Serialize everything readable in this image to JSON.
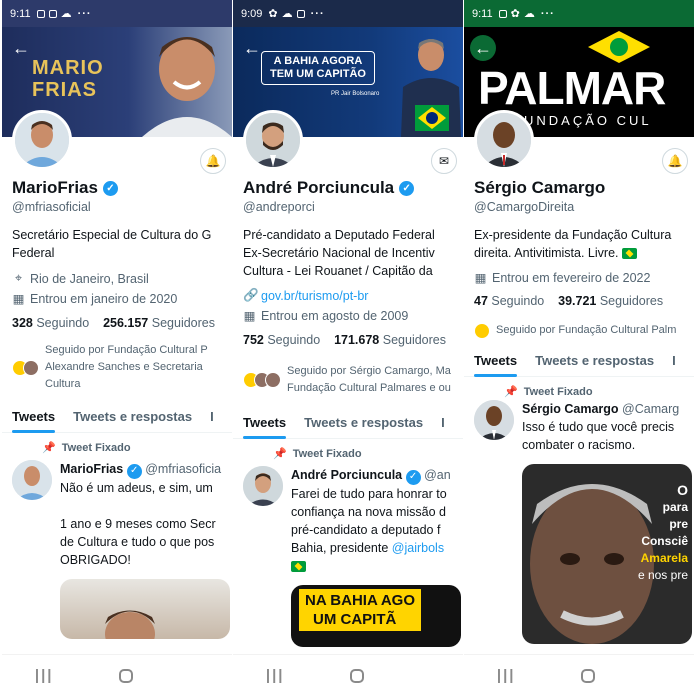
{
  "panels": [
    {
      "status": {
        "time": "9:11",
        "more": "···"
      },
      "banner": {
        "line1": "MARIO",
        "line2": "FRIAS"
      },
      "name": "MarioFrias",
      "handle": "@mfriasoficial",
      "bio": [
        "Secretário Especial de Cultura do G",
        "Federal"
      ],
      "location": "Rio de Janeiro, Brasil",
      "joined": "Entrou em janeiro de 2020",
      "following_count": "328",
      "following_label": "Seguindo",
      "followers_count": "256.157",
      "followers_label": "Seguidores",
      "followed_by": [
        "Seguido por Fundação Cultural P",
        "Alexandre Sanches e Secretaria",
        "Cultura"
      ],
      "tabs": [
        "Tweets",
        "Tweets e respostas",
        "I"
      ],
      "pinned_label": "Tweet Fixado",
      "tweet": {
        "name": "MarioFrias",
        "handle": "@mfriasoficia",
        "lines": [
          "Não é um adeus, e sim, um",
          "",
          "1 ano e 9 meses como Secr",
          "de Cultura e tudo o que pos",
          "OBRIGADO!"
        ]
      }
    },
    {
      "status": {
        "time": "9:09",
        "more": "···"
      },
      "banner": {
        "line1": "A BAHIA AGORA",
        "line2": "TEM UM CAPITÃO",
        "signature": "PR Jair Bolsonaro"
      },
      "name": "André Porciuncula",
      "handle": "@andreporci",
      "bio": [
        "Pré-candidato a Deputado Federal",
        "Ex-Secretário Nacional de Incentiv",
        "Cultura - Lei Rouanet / Capitão da"
      ],
      "link": "gov.br/turismo/pt-br",
      "joined": "Entrou em agosto de 2009",
      "following_count": "752",
      "following_label": "Seguindo",
      "followers_count": "171.678",
      "followers_label": "Seguidores",
      "followed_by": [
        "Seguido por Sérgio Camargo, Ma",
        "Fundação Cultural Palmares e ou"
      ],
      "tabs": [
        "Tweets",
        "Tweets e respostas",
        "I"
      ],
      "pinned_label": "Tweet Fixado",
      "tweet": {
        "name": "André Porciuncula",
        "handle": "@an",
        "lines": [
          "Farei de tudo para honrar to",
          "confiança na nova missão d",
          "pré-candidato a deputado f",
          "Bahia, presidente"
        ],
        "mention": "@jairbols"
      },
      "media_text": [
        "NA BAHIA AGO",
        "UM CAPITÃ"
      ]
    },
    {
      "status": {
        "time": "9:11",
        "more": "···"
      },
      "banner": {
        "line1": "PALMAR",
        "line2": "UNDAÇÃO CUL"
      },
      "name": "Sérgio Camargo",
      "handle": "@CamargoDireita",
      "bio": [
        "Ex-presidente da Fundação Cultura",
        "direita. Antivitimista. Livre."
      ],
      "joined": "Entrou em fevereiro de 2022",
      "following_count": "47",
      "following_label": "Seguindo",
      "followers_count": "39.721",
      "followers_label": "Seguidores",
      "followed_by": [
        "Seguido por Fundação Cultural Palm"
      ],
      "tabs": [
        "Tweets",
        "Tweets e respostas",
        "I"
      ],
      "pinned_label": "Tweet Fixado",
      "tweet": {
        "name": "Sérgio Camargo",
        "handle": "@Camarg",
        "lines": [
          "Isso é tudo que você precis",
          "combater o racismo."
        ]
      },
      "media_text": [
        "O",
        "para",
        "pre",
        "Consciê",
        "Amarela",
        "e nos pre"
      ]
    }
  ],
  "colors": {
    "accent": "#1d9bf0",
    "verified": "#1d9bf0",
    "secondary_text": "#536471"
  }
}
